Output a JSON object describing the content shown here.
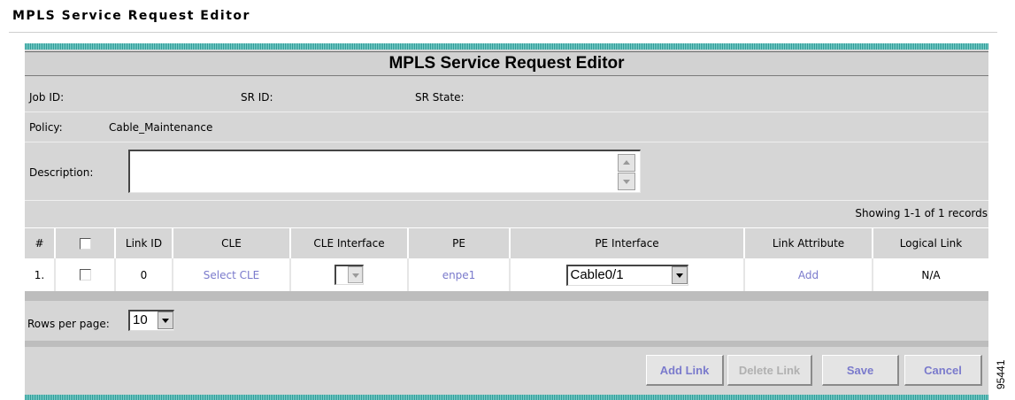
{
  "page_title": "MPLS Service Request Editor",
  "editor": {
    "title": "MPLS Service Request Editor",
    "job_id_label": "Job ID:",
    "sr_id_label": "SR ID:",
    "sr_state_label": "SR State:",
    "policy_label": "Policy:",
    "policy_value": "Cable_Maintenance",
    "description_label": "Description:",
    "description_value": ""
  },
  "records_text": "Showing 1-1 of 1 records",
  "table": {
    "columns": [
      "#",
      "",
      "Link ID",
      "CLE",
      "CLE Interface",
      "PE",
      "PE Interface",
      "Link Attribute",
      "Logical Link"
    ],
    "rows": [
      {
        "index": "1.",
        "link_id": "0",
        "cle": "Select CLE",
        "pe": "enpe1",
        "pe_interface": "Cable0/1",
        "link_attribute": "Add",
        "logical_link": "N/A"
      }
    ]
  },
  "rows_per_page": {
    "label": "Rows per page:",
    "value": "10"
  },
  "actions": {
    "add_link": "Add Link",
    "delete_link": "Delete Link",
    "save": "Save",
    "cancel": "Cancel"
  },
  "figure_id": "95441",
  "colors": {
    "teal": "#2e9a96",
    "link": "#7a7acc",
    "panel": "#d6d6d6"
  },
  "icons": [
    "checkbox",
    "chevron-down-icon",
    "chevron-up-icon"
  ]
}
